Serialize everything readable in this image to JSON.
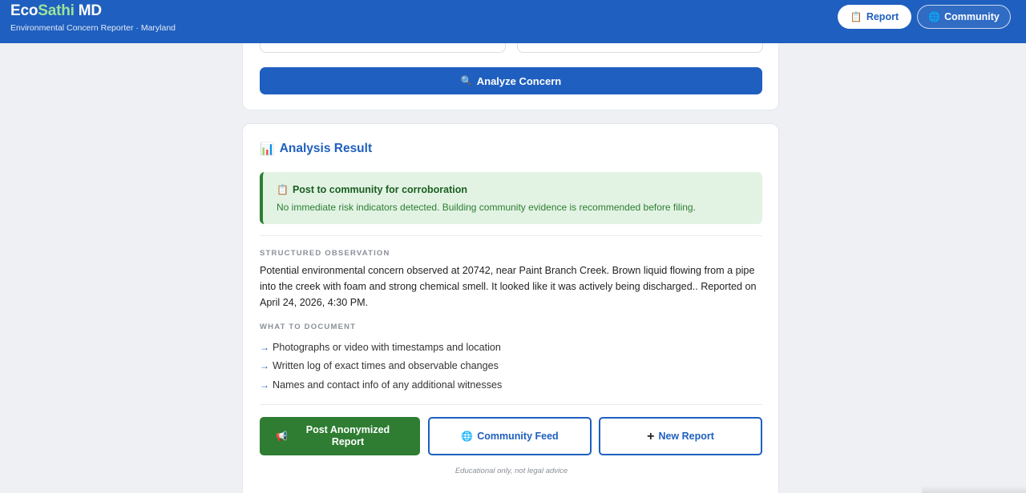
{
  "header": {
    "brand_eco": "Eco",
    "brand_sathi": "Sathi",
    "brand_md": "MD",
    "subtitle": "Environmental Concern Reporter · Maryland",
    "report_label": "Report",
    "community_label": "Community"
  },
  "form": {
    "analyze_label": "Analyze Concern"
  },
  "result": {
    "title": "Analysis Result",
    "alert_title": "Post to community for corroboration",
    "alert_text": "No immediate risk indicators detected. Building community evidence is recommended before filing.",
    "observation_label": "STRUCTURED OBSERVATION",
    "observation_text": "Potential environmental concern observed at 20742, near Paint Branch Creek. Brown liquid flowing from a pipe into the creek with foam and strong chemical smell. It looked like it was actively being discharged.. Reported on April 24, 2026, 4:30 PM.",
    "document_label": "WHAT TO DOCUMENT",
    "document_items": [
      "Photographs or video with timestamps and location",
      "Written log of exact times and observable changes",
      "Names and contact info of any additional witnesses"
    ]
  },
  "actions": {
    "post_label": "Post Anonymized Report",
    "feed_label": "Community Feed",
    "new_label": "New Report"
  },
  "disclaimer": "Educational only, not legal advice",
  "icons": {
    "report": "clipboard-icon",
    "community": "globe-icon",
    "analyze": "magnifier-icon",
    "result": "bar-chart-icon",
    "alert": "clipboard-icon",
    "post": "megaphone-icon",
    "feed": "globe-icon",
    "new": "plus-icon"
  },
  "colors": {
    "primary": "#1f5fbf",
    "success": "#2e7d32",
    "alert_bg": "#e2f3e4"
  }
}
